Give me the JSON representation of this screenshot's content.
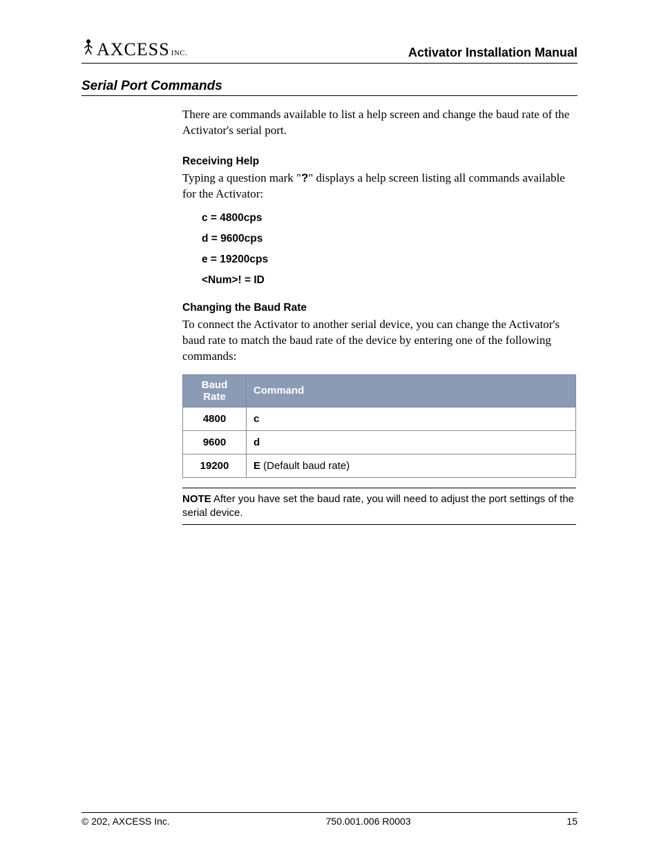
{
  "header": {
    "logo_text": "AXCESS",
    "logo_inc": "INC.",
    "manual_title": "Activator Installation Manual"
  },
  "section": {
    "heading": "Serial Port Commands",
    "intro": "There are commands available to list a help screen and change the baud rate of the Activator's serial port.",
    "help": {
      "subhead": "Receiving Help",
      "text_pre": "Typing a question mark \"",
      "q_mark": "?",
      "text_post": "\" displays a help screen listing all commands available for the Activator:",
      "items": [
        "c = 4800cps",
        "d = 9600cps",
        "e = 19200cps",
        "<Num>! = ID"
      ]
    },
    "baud": {
      "subhead": "Changing the Baud Rate",
      "text": "To connect the Activator to another serial device, you can change the Activator's baud rate to match the baud rate of the device by entering one of the following commands:",
      "table": {
        "col1": "Baud Rate",
        "col2": "Command",
        "rows": [
          {
            "rate": "4800",
            "cmd": "c",
            "suffix": ""
          },
          {
            "rate": "9600",
            "cmd": "d",
            "suffix": ""
          },
          {
            "rate": "19200",
            "cmd": "E",
            "suffix": " (Default baud rate)"
          }
        ]
      }
    },
    "note": {
      "label": "NOTE",
      "text": "  After you have set the baud rate, you will need to adjust the port settings of the serial device."
    }
  },
  "footer": {
    "left": "© 202, AXCESS Inc.",
    "center": "750.001.006 R0003",
    "right": "15"
  }
}
